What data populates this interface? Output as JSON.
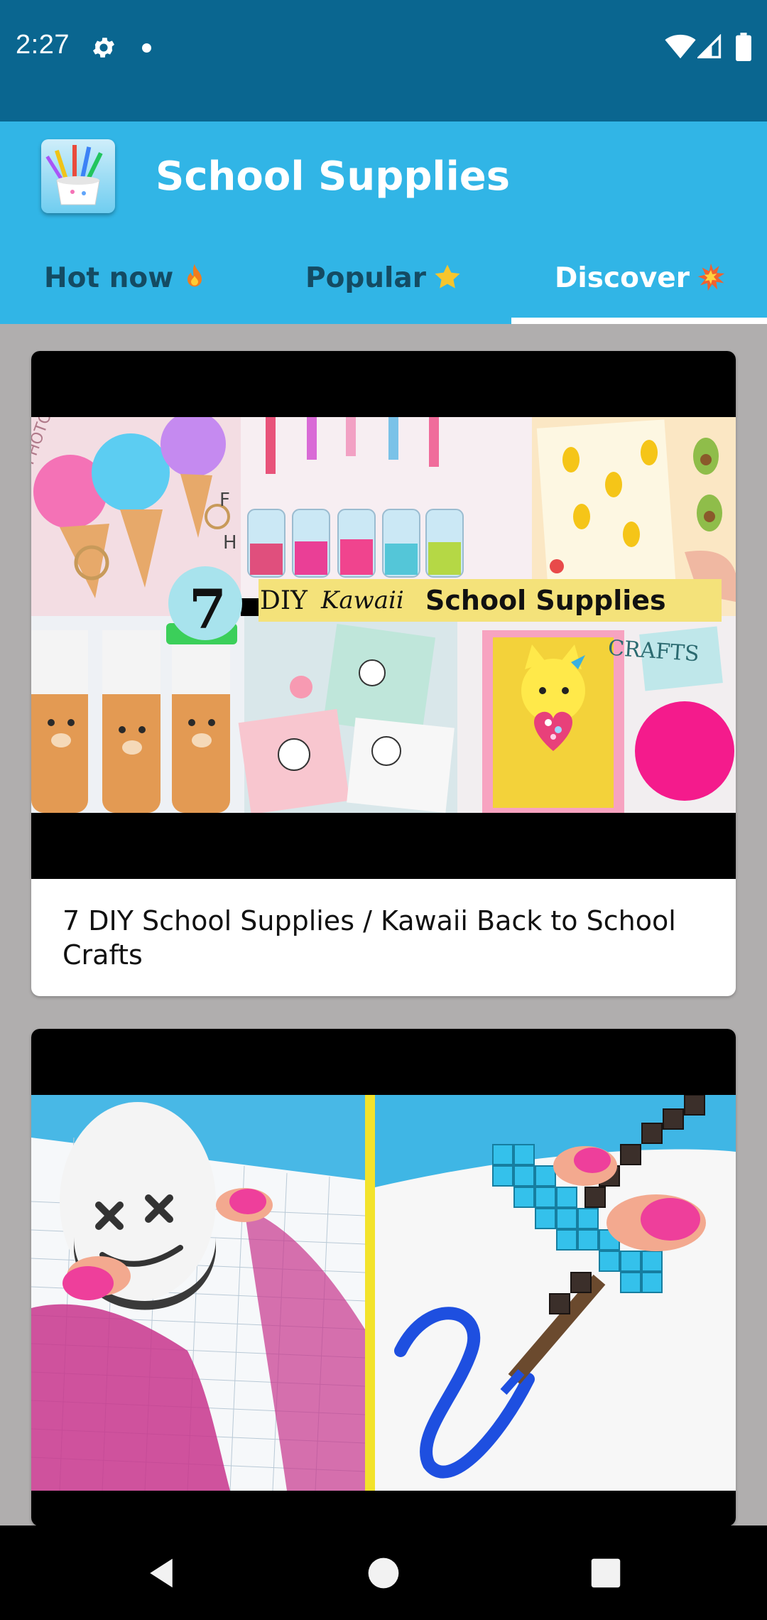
{
  "status_bar": {
    "time": "2:27",
    "icons": [
      "gear-icon",
      "notification-dot-icon",
      "wifi-icon",
      "cell-signal-icon",
      "battery-icon"
    ]
  },
  "app_bar": {
    "title": "School Supplies",
    "logo_icon": "pencil-cup-logo-icon",
    "background_color": "#31b5e6"
  },
  "tabs": [
    {
      "label": "Hot now",
      "emoji_icon": "fire-icon",
      "selected": false
    },
    {
      "label": "Popular",
      "emoji_icon": "star-icon",
      "selected": false
    },
    {
      "label": "Discover",
      "emoji_icon": "collision-icon",
      "selected": true
    }
  ],
  "feed": {
    "items": [
      {
        "title": "7 DIY School Supplies / Kawaii Back to School Crafts",
        "thumbnail_text": {
          "number": "7",
          "prefix": "DIY",
          "script": "Kawaii",
          "headline": "School Supplies",
          "crafts": "CRAFTS"
        }
      },
      {
        "title": "",
        "thumbnail_text": {}
      }
    ]
  },
  "nav_bar": {
    "buttons": [
      "back-icon",
      "home-icon",
      "recents-icon"
    ]
  },
  "colors": {
    "status_bar": "#0a6690",
    "tab_selected": "#ffffff",
    "tab_unselected": "#144b63",
    "page_background": "#b0aeae"
  }
}
